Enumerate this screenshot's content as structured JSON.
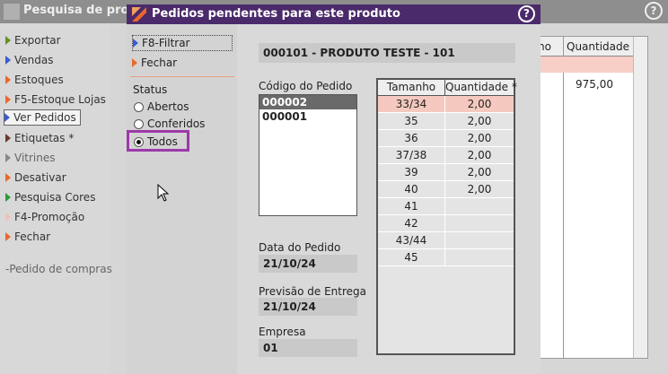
{
  "background_window": {
    "title": "Pesquisa de produ",
    "menu": [
      {
        "label": "Exportar",
        "color": "#6b8e23"
      },
      {
        "label": "Vendas",
        "color": "#3a5bd0"
      },
      {
        "label": "Estoques",
        "color": "#e8692a"
      },
      {
        "label": "F5-Estoque Lojas",
        "color": "#e8692a"
      },
      {
        "label": "Ver Pedidos",
        "color": "#3a5bd0"
      },
      {
        "label": "Etiquetas *",
        "color": "#6b3a2a"
      },
      {
        "label": "Vitrines",
        "color": "#8a8a8a"
      },
      {
        "label": "Desativar",
        "color": "#e8692a"
      },
      {
        "label": "Pesquisa Cores",
        "color": "#2a9b3a"
      },
      {
        "label": "F4-Promoção",
        "color": "#f2c0b8"
      },
      {
        "label": "Fechar",
        "color": "#e8692a"
      }
    ],
    "extra_link": "-Pedido de compras",
    "right_table": {
      "col1_header": "no",
      "col2_header": "Quantidade *",
      "value": "975,00"
    }
  },
  "dialog": {
    "title": "Pedidos pendentes para este produto",
    "help_label": "?",
    "buttons": {
      "filter": "F8-Filtrar",
      "close": "Fechar"
    },
    "status_label": "Status",
    "status_options": [
      {
        "label": "Abertos",
        "checked": false
      },
      {
        "label": "Conferidos",
        "checked": false
      },
      {
        "label": "Todos",
        "checked": true
      }
    ],
    "product": "000101 - PRODUTO TESTE - 101",
    "order_code_label": "Código do Pedido",
    "order_codes": [
      {
        "code": "000002",
        "selected": true
      },
      {
        "code": "000001",
        "selected": false
      }
    ],
    "order_date_label": "Data do Pedido",
    "order_date": "21/10/24",
    "delivery_label": "Previsão de Entrega",
    "delivery_date": "21/10/24",
    "company_label": "Empresa",
    "company": "01",
    "size_table": {
      "headers": [
        "Tamanho",
        "Quantidade *"
      ],
      "rows": [
        {
          "size": "33/34",
          "qty": "2,00"
        },
        {
          "size": "35",
          "qty": "2,00"
        },
        {
          "size": "36",
          "qty": "2,00"
        },
        {
          "size": "37/38",
          "qty": "2,00"
        },
        {
          "size": "39",
          "qty": "2,00"
        },
        {
          "size": "40",
          "qty": "2,00"
        },
        {
          "size": "41",
          "qty": ""
        },
        {
          "size": "42",
          "qty": ""
        },
        {
          "size": "43/44",
          "qty": ""
        },
        {
          "size": "45",
          "qty": ""
        }
      ]
    }
  },
  "colors": {
    "dialog_titlebar": "#4a2a6a",
    "highlight_border": "#9b3aa8",
    "selected_row": "#f5c9bf"
  }
}
